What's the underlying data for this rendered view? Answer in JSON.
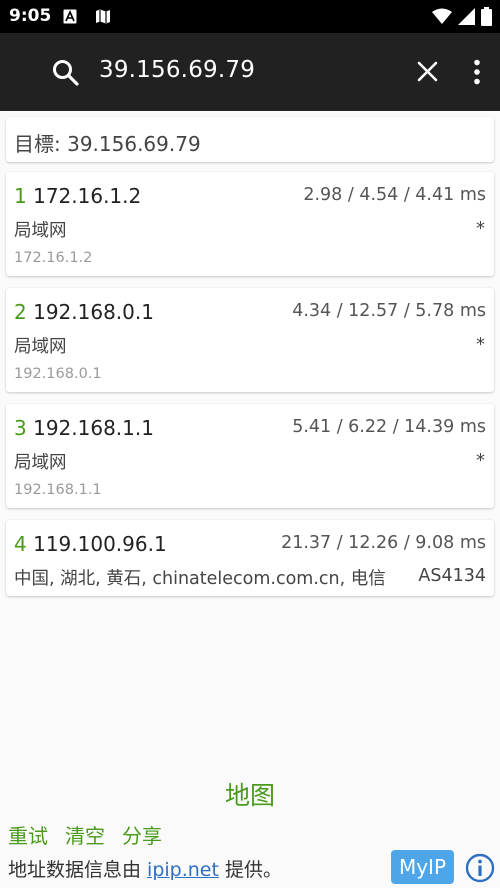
{
  "status_bar": {
    "time": "9:05",
    "icons": [
      "app-notification-icon",
      "map-notification-icon",
      "wifi-icon",
      "signal-icon",
      "battery-icon"
    ]
  },
  "search": {
    "query": "39.156.69.79",
    "icons": [
      "search-icon",
      "clear-icon",
      "more-options-icon"
    ]
  },
  "target": {
    "label": "目標: 39.156.69.79"
  },
  "hops": [
    {
      "num": "1",
      "ip": "172.16.1.2",
      "times": "2.98 / 4.54 / 4.41 ms",
      "location": "局域网",
      "extra": "*",
      "host": "172.16.1.2"
    },
    {
      "num": "2",
      "ip": "192.168.0.1",
      "times": "4.34 / 12.57 / 5.78 ms",
      "location": "局域网",
      "extra": "*",
      "host": "192.168.0.1"
    },
    {
      "num": "3",
      "ip": "192.168.1.1",
      "times": "5.41 / 6.22 / 14.39 ms",
      "location": "局域网",
      "extra": "*",
      "host": "192.168.1.1"
    },
    {
      "num": "4",
      "ip": "119.100.96.1",
      "times": "21.37 / 12.26 / 9.08 ms",
      "location": "中国, 湖北, 黄石, chinatelecom.com.cn, 电信",
      "extra": "AS4134"
    }
  ],
  "bottom": {
    "map_label": "地图",
    "actions": [
      "重试",
      "清空",
      "分享"
    ],
    "footer_prefix": "地址数据信息由 ",
    "footer_link": "ipip.net",
    "footer_suffix": " 提供。",
    "myip_label": "MyIP"
  },
  "colors": {
    "accent_green": "#4a9a1b",
    "link_blue": "#2f6fc1",
    "myip_blue": "#4ea6e9",
    "toolbar": "#212121"
  }
}
